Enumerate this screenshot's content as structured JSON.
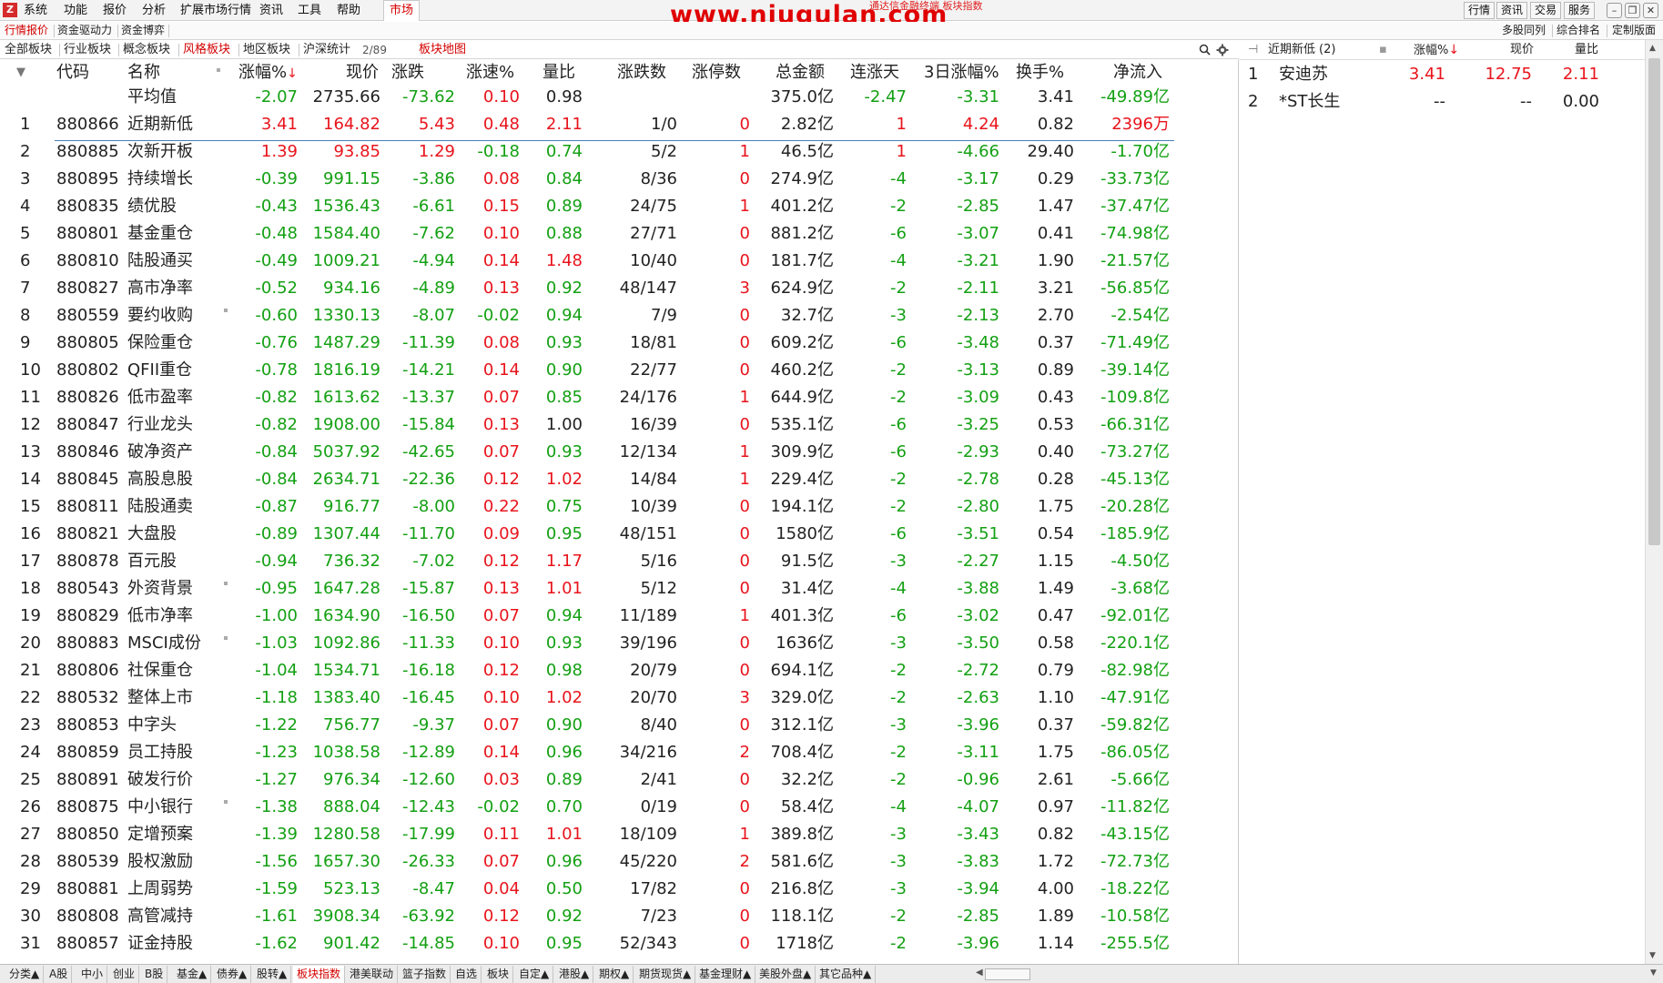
{
  "menubar": {
    "items": [
      "系统",
      "功能",
      "报价",
      "分析",
      "扩展市场行情",
      "资讯",
      "工具",
      "帮助"
    ],
    "market_tab": "市场",
    "watermark": "www.niugulan.com",
    "title": "通达信金融终端 板块指数",
    "right_buttons": [
      "行情",
      "资讯",
      "交易",
      "服务"
    ]
  },
  "row2": {
    "tabs": [
      "行情报价",
      "资金驱动力",
      "资金博弈"
    ],
    "right_tabs": [
      "多股同列",
      "综合排名",
      "定制版面"
    ]
  },
  "row3": {
    "tabs": [
      "全部板块",
      "行业板块",
      "概念板块",
      "风格板块",
      "地区板块",
      "沪深统计"
    ],
    "active_tab": "风格板块",
    "page_indicator": "2/89",
    "map_link": "板块地图"
  },
  "table": {
    "headers": [
      "代码",
      "名称",
      "涨幅%",
      "现价",
      "涨跌",
      "涨速%",
      "量比",
      "涨跌数",
      "涨停数",
      "总金额",
      "连涨天",
      "3日涨幅%",
      "换手%",
      "净流入"
    ],
    "sort_arrow": "↓",
    "average": {
      "label": "平均值",
      "change_pct": "-2.07",
      "price": "2735.66",
      "change": "-73.62",
      "speed": "0.10",
      "vol_ratio": "0.98",
      "amount": "375.0亿",
      "days": "-2.47",
      "three_day": "-3.31",
      "turnover": "3.41",
      "net_inflow": "-49.89亿"
    },
    "rows": [
      {
        "no": "1",
        "code": "880866",
        "name": "近期新低",
        "chg": "3.41",
        "price": "164.82",
        "diff": "5.43",
        "speed": "0.48",
        "vr": "2.11",
        "ud": "1/0",
        "lu": "0",
        "amt": "2.82亿",
        "days": "1",
        "d3": "4.24",
        "to": "0.82",
        "net": "2396万"
      },
      {
        "no": "2",
        "code": "880885",
        "name": "次新开板",
        "chg": "1.39",
        "price": "93.85",
        "diff": "1.29",
        "speed": "-0.18",
        "vr": "0.74",
        "ud": "5/2",
        "lu": "1",
        "amt": "46.5亿",
        "days": "1",
        "d3": "-4.66",
        "to": "29.40",
        "net": "-1.70亿"
      },
      {
        "no": "3",
        "code": "880895",
        "name": "持续增长",
        "chg": "-0.39",
        "price": "991.15",
        "diff": "-3.86",
        "speed": "0.08",
        "vr": "0.84",
        "ud": "8/36",
        "lu": "0",
        "amt": "274.9亿",
        "days": "-4",
        "d3": "-3.17",
        "to": "0.29",
        "net": "-33.73亿"
      },
      {
        "no": "4",
        "code": "880835",
        "name": "绩优股",
        "chg": "-0.43",
        "price": "1536.43",
        "diff": "-6.61",
        "speed": "0.15",
        "vr": "0.89",
        "ud": "24/75",
        "lu": "1",
        "amt": "401.2亿",
        "days": "-2",
        "d3": "-2.85",
        "to": "1.47",
        "net": "-37.47亿"
      },
      {
        "no": "5",
        "code": "880801",
        "name": "基金重仓",
        "chg": "-0.48",
        "price": "1584.40",
        "diff": "-7.62",
        "speed": "0.10",
        "vr": "0.88",
        "ud": "27/71",
        "lu": "0",
        "amt": "881.2亿",
        "days": "-6",
        "d3": "-3.07",
        "to": "0.41",
        "net": "-74.98亿"
      },
      {
        "no": "6",
        "code": "880810",
        "name": "陆股通买",
        "chg": "-0.49",
        "price": "1009.21",
        "diff": "-4.94",
        "speed": "0.14",
        "vr": "1.48",
        "ud": "10/40",
        "lu": "0",
        "amt": "181.7亿",
        "days": "-4",
        "d3": "-3.21",
        "to": "1.90",
        "net": "-21.57亿"
      },
      {
        "no": "7",
        "code": "880827",
        "name": "高市净率",
        "chg": "-0.52",
        "price": "934.16",
        "diff": "-4.89",
        "speed": "0.13",
        "vr": "0.92",
        "ud": "48/147",
        "lu": "3",
        "amt": "624.9亿",
        "days": "-2",
        "d3": "-2.11",
        "to": "3.21",
        "net": "-56.85亿"
      },
      {
        "no": "8",
        "code": "880559",
        "name": "要约收购",
        "chg": "-0.60",
        "price": "1330.13",
        "diff": "-8.07",
        "speed": "-0.02",
        "vr": "0.94",
        "ud": "7/9",
        "lu": "0",
        "amt": "32.7亿",
        "days": "-3",
        "d3": "-2.13",
        "to": "2.70",
        "net": "-2.54亿"
      },
      {
        "no": "9",
        "code": "880805",
        "name": "保险重仓",
        "chg": "-0.76",
        "price": "1487.29",
        "diff": "-11.39",
        "speed": "0.08",
        "vr": "0.93",
        "ud": "18/81",
        "lu": "0",
        "amt": "609.2亿",
        "days": "-6",
        "d3": "-3.48",
        "to": "0.37",
        "net": "-71.49亿"
      },
      {
        "no": "10",
        "code": "880802",
        "name": "QFII重仓",
        "chg": "-0.78",
        "price": "1816.19",
        "diff": "-14.21",
        "speed": "0.14",
        "vr": "0.90",
        "ud": "22/77",
        "lu": "0",
        "amt": "460.2亿",
        "days": "-2",
        "d3": "-3.13",
        "to": "0.89",
        "net": "-39.14亿"
      },
      {
        "no": "11",
        "code": "880826",
        "name": "低市盈率",
        "chg": "-0.82",
        "price": "1613.62",
        "diff": "-13.37",
        "speed": "0.07",
        "vr": "0.85",
        "ud": "24/176",
        "lu": "1",
        "amt": "644.9亿",
        "days": "-2",
        "d3": "-3.09",
        "to": "0.43",
        "net": "-109.8亿"
      },
      {
        "no": "12",
        "code": "880847",
        "name": "行业龙头",
        "chg": "-0.82",
        "price": "1908.00",
        "diff": "-15.84",
        "speed": "0.13",
        "vr": "1.00",
        "ud": "16/39",
        "lu": "0",
        "amt": "535.1亿",
        "days": "-6",
        "d3": "-3.25",
        "to": "0.53",
        "net": "-66.31亿"
      },
      {
        "no": "13",
        "code": "880846",
        "name": "破净资产",
        "chg": "-0.84",
        "price": "5037.92",
        "diff": "-42.65",
        "speed": "0.07",
        "vr": "0.93",
        "ud": "12/134",
        "lu": "1",
        "amt": "309.9亿",
        "days": "-6",
        "d3": "-2.93",
        "to": "0.40",
        "net": "-73.27亿"
      },
      {
        "no": "14",
        "code": "880845",
        "name": "高股息股",
        "chg": "-0.84",
        "price": "2634.71",
        "diff": "-22.36",
        "speed": "0.12",
        "vr": "1.02",
        "ud": "14/84",
        "lu": "1",
        "amt": "229.4亿",
        "days": "-2",
        "d3": "-2.78",
        "to": "0.28",
        "net": "-45.13亿"
      },
      {
        "no": "15",
        "code": "880811",
        "name": "陆股通卖",
        "chg": "-0.87",
        "price": "916.77",
        "diff": "-8.00",
        "speed": "0.22",
        "vr": "0.75",
        "ud": "10/39",
        "lu": "0",
        "amt": "194.1亿",
        "days": "-2",
        "d3": "-2.80",
        "to": "1.75",
        "net": "-20.28亿"
      },
      {
        "no": "16",
        "code": "880821",
        "name": "大盘股",
        "chg": "-0.89",
        "price": "1307.44",
        "diff": "-11.70",
        "speed": "0.09",
        "vr": "0.95",
        "ud": "48/151",
        "lu": "0",
        "amt": "1580亿",
        "days": "-6",
        "d3": "-3.51",
        "to": "0.54",
        "net": "-185.9亿"
      },
      {
        "no": "17",
        "code": "880878",
        "name": "百元股",
        "chg": "-0.94",
        "price": "736.32",
        "diff": "-7.02",
        "speed": "0.12",
        "vr": "1.17",
        "ud": "5/16",
        "lu": "0",
        "amt": "91.5亿",
        "days": "-3",
        "d3": "-2.27",
        "to": "1.15",
        "net": "-4.50亿"
      },
      {
        "no": "18",
        "code": "880543",
        "name": "外资背景",
        "chg": "-0.95",
        "price": "1647.28",
        "diff": "-15.87",
        "speed": "0.13",
        "vr": "1.01",
        "ud": "5/12",
        "lu": "0",
        "amt": "31.4亿",
        "days": "-4",
        "d3": "-3.88",
        "to": "1.49",
        "net": "-3.68亿"
      },
      {
        "no": "19",
        "code": "880829",
        "name": "低市净率",
        "chg": "-1.00",
        "price": "1634.90",
        "diff": "-16.50",
        "speed": "0.07",
        "vr": "0.94",
        "ud": "11/189",
        "lu": "1",
        "amt": "401.3亿",
        "days": "-6",
        "d3": "-3.02",
        "to": "0.47",
        "net": "-92.01亿"
      },
      {
        "no": "20",
        "code": "880883",
        "name": "MSCI成份",
        "chg": "-1.03",
        "price": "1092.86",
        "diff": "-11.33",
        "speed": "0.10",
        "vr": "0.93",
        "ud": "39/196",
        "lu": "0",
        "amt": "1636亿",
        "days": "-3",
        "d3": "-3.50",
        "to": "0.58",
        "net": "-220.1亿"
      },
      {
        "no": "21",
        "code": "880806",
        "name": "社保重仓",
        "chg": "-1.04",
        "price": "1534.71",
        "diff": "-16.18",
        "speed": "0.12",
        "vr": "0.98",
        "ud": "20/79",
        "lu": "0",
        "amt": "694.1亿",
        "days": "-2",
        "d3": "-2.72",
        "to": "0.79",
        "net": "-82.98亿"
      },
      {
        "no": "22",
        "code": "880532",
        "name": "整体上市",
        "chg": "-1.18",
        "price": "1383.40",
        "diff": "-16.45",
        "speed": "0.10",
        "vr": "1.02",
        "ud": "20/70",
        "lu": "3",
        "amt": "329.0亿",
        "days": "-2",
        "d3": "-2.63",
        "to": "1.10",
        "net": "-47.91亿"
      },
      {
        "no": "23",
        "code": "880853",
        "name": "中字头",
        "chg": "-1.22",
        "price": "756.77",
        "diff": "-9.37",
        "speed": "0.07",
        "vr": "0.90",
        "ud": "8/40",
        "lu": "0",
        "amt": "312.1亿",
        "days": "-3",
        "d3": "-3.96",
        "to": "0.37",
        "net": "-59.82亿"
      },
      {
        "no": "24",
        "code": "880859",
        "name": "员工持股",
        "chg": "-1.23",
        "price": "1038.58",
        "diff": "-12.89",
        "speed": "0.14",
        "vr": "0.96",
        "ud": "34/216",
        "lu": "2",
        "amt": "708.4亿",
        "days": "-2",
        "d3": "-3.11",
        "to": "1.75",
        "net": "-86.05亿"
      },
      {
        "no": "25",
        "code": "880891",
        "name": "破发行价",
        "chg": "-1.27",
        "price": "976.34",
        "diff": "-12.60",
        "speed": "0.03",
        "vr": "0.89",
        "ud": "2/41",
        "lu": "0",
        "amt": "32.2亿",
        "days": "-2",
        "d3": "-0.96",
        "to": "2.61",
        "net": "-5.66亿"
      },
      {
        "no": "26",
        "code": "880875",
        "name": "中小银行",
        "chg": "-1.38",
        "price": "888.04",
        "diff": "-12.43",
        "speed": "-0.02",
        "vr": "0.70",
        "ud": "0/19",
        "lu": "0",
        "amt": "58.4亿",
        "days": "-4",
        "d3": "-4.07",
        "to": "0.97",
        "net": "-11.82亿"
      },
      {
        "no": "27",
        "code": "880850",
        "name": "定增预案",
        "chg": "-1.39",
        "price": "1280.58",
        "diff": "-17.99",
        "speed": "0.11",
        "vr": "1.01",
        "ud": "18/109",
        "lu": "1",
        "amt": "389.8亿",
        "days": "-3",
        "d3": "-3.43",
        "to": "0.82",
        "net": "-43.15亿"
      },
      {
        "no": "28",
        "code": "880539",
        "name": "股权激励",
        "chg": "-1.56",
        "price": "1657.30",
        "diff": "-26.33",
        "speed": "0.07",
        "vr": "0.96",
        "ud": "45/220",
        "lu": "2",
        "amt": "581.6亿",
        "days": "-3",
        "d3": "-3.83",
        "to": "1.72",
        "net": "-72.73亿"
      },
      {
        "no": "29",
        "code": "880881",
        "name": "上周弱势",
        "chg": "-1.59",
        "price": "523.13",
        "diff": "-8.47",
        "speed": "0.04",
        "vr": "0.50",
        "ud": "17/82",
        "lu": "0",
        "amt": "216.8亿",
        "days": "-3",
        "d3": "-3.94",
        "to": "4.00",
        "net": "-18.22亿"
      },
      {
        "no": "30",
        "code": "880808",
        "name": "高管减持",
        "chg": "-1.61",
        "price": "3908.34",
        "diff": "-63.92",
        "speed": "0.12",
        "vr": "0.92",
        "ud": "7/23",
        "lu": "0",
        "amt": "118.1亿",
        "days": "-2",
        "d3": "-2.85",
        "to": "1.89",
        "net": "-10.58亿"
      },
      {
        "no": "31",
        "code": "880857",
        "name": "证金持股",
        "chg": "-1.62",
        "price": "901.42",
        "diff": "-14.85",
        "speed": "0.10",
        "vr": "0.95",
        "ud": "52/343",
        "lu": "0",
        "amt": "1718亿",
        "days": "-2",
        "d3": "-3.96",
        "to": "1.14",
        "net": "-255.5亿"
      }
    ]
  },
  "right_panel": {
    "title": "近期新低",
    "count": "(2)",
    "headers": [
      "涨幅%",
      "现价",
      "量比"
    ],
    "sort_arrow": "↓",
    "rows": [
      {
        "no": "1",
        "name": "安迪苏",
        "chg": "3.41",
        "price": "12.75",
        "vr": "2.11"
      },
      {
        "no": "2",
        "name": "*ST长生",
        "chg": "--",
        "price": "--",
        "vr": "0.00"
      }
    ]
  },
  "bottom_tabs": {
    "items": [
      "分类▲",
      "A股",
      "中小",
      "创业",
      "B股",
      "基金▲",
      "债券▲",
      "股转▲",
      "板块指数",
      "港美联动",
      "篮子指数",
      "自选",
      "板块",
      "自定▲",
      "港股▲",
      "期权▲",
      "期货现货▲",
      "基金理财▲",
      "美股外盘▲",
      "其它品种▲"
    ],
    "active": "板块指数"
  },
  "colors": {
    "up": "#e8141c",
    "down": "#13a013",
    "accent": "#d40000"
  }
}
